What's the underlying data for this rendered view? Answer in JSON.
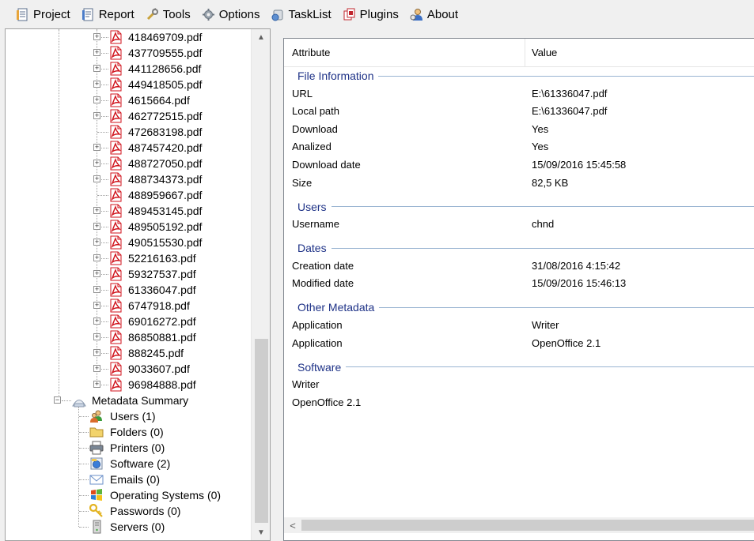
{
  "menu": [
    {
      "label": "Project",
      "icon": "project-icon"
    },
    {
      "label": "Report",
      "icon": "report-icon"
    },
    {
      "label": "Tools",
      "icon": "tools-icon"
    },
    {
      "label": "Options",
      "icon": "gear-icon"
    },
    {
      "label": "TaskList",
      "icon": "tasklist-icon"
    },
    {
      "label": "Plugins",
      "icon": "plugins-icon"
    },
    {
      "label": "About",
      "icon": "about-icon"
    }
  ],
  "tree": {
    "files": [
      {
        "name": "418469709.pdf",
        "expandable": true
      },
      {
        "name": "437709555.pdf",
        "expandable": true
      },
      {
        "name": "441128656.pdf",
        "expandable": true
      },
      {
        "name": "449418505.pdf",
        "expandable": true
      },
      {
        "name": "4615664.pdf",
        "expandable": true
      },
      {
        "name": "462772515.pdf",
        "expandable": true
      },
      {
        "name": "472683198.pdf",
        "expandable": false
      },
      {
        "name": "487457420.pdf",
        "expandable": true
      },
      {
        "name": "488727050.pdf",
        "expandable": true
      },
      {
        "name": "488734373.pdf",
        "expandable": true
      },
      {
        "name": "488959667.pdf",
        "expandable": false
      },
      {
        "name": "489453145.pdf",
        "expandable": true
      },
      {
        "name": "489505192.pdf",
        "expandable": true
      },
      {
        "name": "490515530.pdf",
        "expandable": true
      },
      {
        "name": "52216163.pdf",
        "expandable": true
      },
      {
        "name": "59327537.pdf",
        "expandable": true
      },
      {
        "name": "61336047.pdf",
        "expandable": true
      },
      {
        "name": "6747918.pdf",
        "expandable": true
      },
      {
        "name": "69016272.pdf",
        "expandable": true
      },
      {
        "name": "86850881.pdf",
        "expandable": true
      },
      {
        "name": "888245.pdf",
        "expandable": true
      },
      {
        "name": "9033607.pdf",
        "expandable": true
      },
      {
        "name": "96984888.pdf",
        "expandable": true
      }
    ],
    "summary_label": "Metadata Summary",
    "summary_items": [
      {
        "label": "Users (1)",
        "icon": "users-icon",
        "color": "#3a9c3a"
      },
      {
        "label": "Folders (0)",
        "icon": "folder-icon",
        "color": "#f2d36b"
      },
      {
        "label": "Printers (0)",
        "icon": "printer-icon",
        "color": "#7a8796"
      },
      {
        "label": "Software (2)",
        "icon": "software-icon",
        "color": "#3b7dd8"
      },
      {
        "label": "Emails (0)",
        "icon": "email-icon",
        "color": "#6a8fc8"
      },
      {
        "label": "Operating Systems (0)",
        "icon": "windows-icon",
        "color": "#e04b1a"
      },
      {
        "label": "Passwords (0)",
        "icon": "key-icon",
        "color": "#e3b321"
      },
      {
        "label": "Servers (0)",
        "icon": "server-icon",
        "color": "#9a9a9a"
      }
    ]
  },
  "grid": {
    "col_attribute": "Attribute",
    "col_value": "Value",
    "groups": [
      {
        "title": "File Information",
        "rows": [
          {
            "attr": "URL",
            "value": "E:\\61336047.pdf"
          },
          {
            "attr": "Local path",
            "value": "E:\\61336047.pdf"
          },
          {
            "attr": "Download",
            "value": "Yes"
          },
          {
            "attr": "Analized",
            "value": "Yes"
          },
          {
            "attr": "Download date",
            "value": "15/09/2016 15:45:58"
          },
          {
            "attr": "Size",
            "value": "82,5 KB"
          }
        ]
      },
      {
        "title": "Users",
        "rows": [
          {
            "attr": "Username",
            "value": "chnd"
          }
        ]
      },
      {
        "title": "Dates",
        "rows": [
          {
            "attr": "Creation date",
            "value": "31/08/2016 4:15:42"
          },
          {
            "attr": "Modified date",
            "value": "15/09/2016 15:46:13"
          }
        ]
      },
      {
        "title": "Other Metadata",
        "rows": [
          {
            "attr": "Application",
            "value": "Writer"
          },
          {
            "attr": "Application",
            "value": "OpenOffice 2.1"
          }
        ]
      },
      {
        "title": "Software",
        "rows": [
          {
            "attr": "Writer",
            "value": ""
          },
          {
            "attr": "OpenOffice 2.1",
            "value": ""
          }
        ]
      }
    ]
  },
  "colors": {
    "group_title": "#1e3287",
    "group_line": "#99b4d1",
    "pdf_red": "#d0121b"
  }
}
